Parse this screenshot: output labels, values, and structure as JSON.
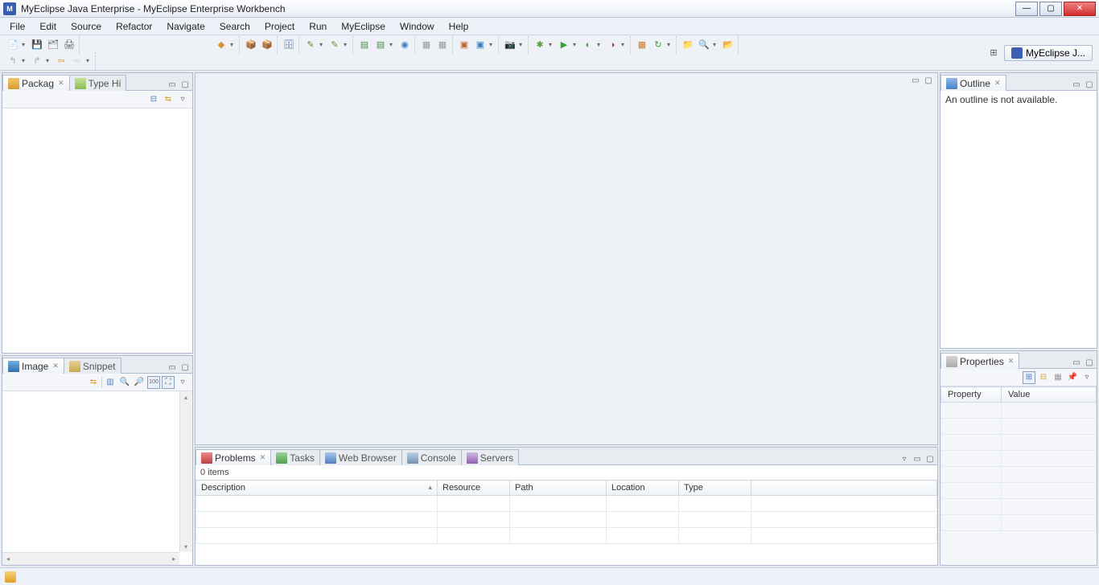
{
  "title": "MyEclipse Java Enterprise - MyEclipse Enterprise Workbench",
  "menu": [
    "File",
    "Edit",
    "Source",
    "Refactor",
    "Navigate",
    "Search",
    "Project",
    "Run",
    "MyEclipse",
    "Window",
    "Help"
  ],
  "perspective": {
    "label": "MyEclipse J..."
  },
  "views": {
    "package": {
      "tab": "Packag"
    },
    "typeHierarchy": {
      "tab": "Type Hi"
    },
    "image": {
      "tab": "Image"
    },
    "snippet": {
      "tab": "Snippet"
    },
    "outline": {
      "tab": "Outline",
      "empty_msg": "An outline is not available."
    },
    "properties": {
      "tab": "Properties",
      "columns": [
        "Property",
        "Value"
      ],
      "rows": []
    },
    "problems": {
      "tab": "Problems",
      "items_label": "0 items",
      "columns": [
        "Description",
        "Resource",
        "Path",
        "Location",
        "Type"
      ],
      "rows": []
    },
    "tasks": {
      "tab": "Tasks"
    },
    "webBrowser": {
      "tab": "Web Browser"
    },
    "console": {
      "tab": "Console"
    },
    "servers": {
      "tab": "Servers"
    }
  }
}
